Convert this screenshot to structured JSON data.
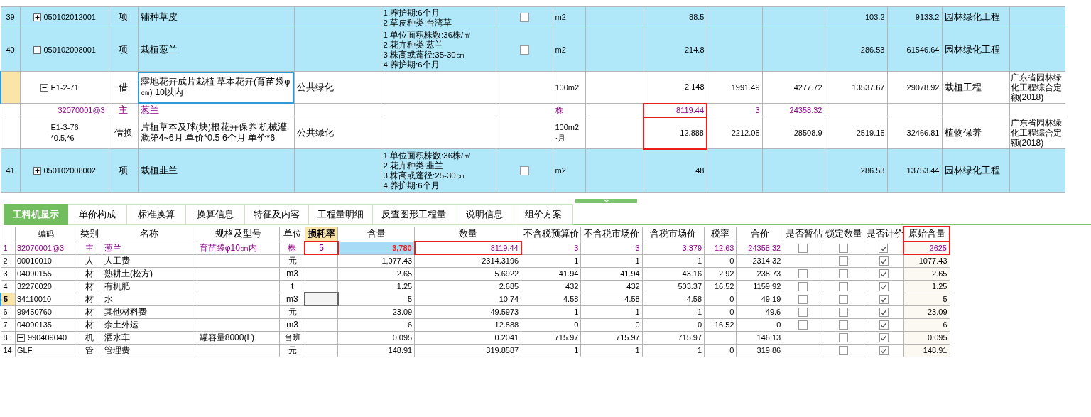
{
  "upper_grid": {
    "rows": [
      {
        "kind": "item",
        "number": "39",
        "current": false,
        "expanded": false,
        "code": "050102012001",
        "type": "项",
        "name": "铺种草皮",
        "features": [
          "1.养护期:6个月",
          "2.草皮种类:台湾草"
        ],
        "checked": false,
        "unit": "m2",
        "quantity": "88.5",
        "col_13": "103.2",
        "col_14": "9133.2",
        "category": "园林绿化工程",
        "quantity_highlighted": false
      },
      {
        "kind": "item",
        "number": "40",
        "current": false,
        "expanded": true,
        "code": "050102008001",
        "type": "项",
        "name": "栽植葱兰",
        "features": [
          "1.单位面积株数:36株/㎡",
          "2.花卉种类:葱兰",
          "3.株高或蓬径:35-30㎝",
          "4.养护期:6个月"
        ],
        "checked": false,
        "unit": "m2",
        "quantity": "214.8",
        "col_13": "286.53",
        "col_14": "61546.64",
        "category": "园林绿化工程",
        "quantity_highlighted": false,
        "children": [
          {
            "kind": "quota",
            "current": true,
            "expanded": true,
            "code": "E1-2-71",
            "type": "借",
            "name": "露地花卉成片栽植 草本花卉(育苗袋φ㎝) 10以内",
            "col_5": "公共绿化",
            "unit": "100m2",
            "quantity": "2.148",
            "col_11": "1991.49",
            "col_12": "4277.72",
            "col_13": "13537.67",
            "col_14": "29078.92",
            "category": "栽植工程",
            "col_16": "广东省园林绿化工程综合定额(2018)",
            "quantity_highlighted": false,
            "children": [
              {
                "kind": "material",
                "current": false,
                "code": "32070001@3",
                "type": "主",
                "name": "葱兰",
                "unit": "株",
                "quantity": "8119.44",
                "col_11": "3",
                "col_12": "24358.32",
                "quantity_highlighted": true
              }
            ]
          },
          {
            "kind": "quota",
            "current": false,
            "code": "E1-3-76\n*0.5,*6",
            "type": "借换",
            "name": "片植草本及球(块)根花卉保养 机械灌溉第4~6月 单价*0.5 6个月 单价*6",
            "col_5": "公共绿化",
            "unit": "100m2\n·月",
            "quantity": "12.888",
            "col_11": "2212.05",
            "col_12": "28508.9",
            "col_13": "2519.15",
            "col_14": "32466.81",
            "category": "植物保养",
            "col_16": "广东省园林绿化工程综合定额(2018)",
            "quantity_highlighted": true
          }
        ]
      },
      {
        "kind": "item",
        "number": "41",
        "current": false,
        "expanded": false,
        "code": "050102008002",
        "type": "项",
        "name": "栽植韭兰",
        "features": [
          "1.单位面积株数:36株/㎡",
          "2.花卉种类:韭兰",
          "3.株高或蓬径:25-30㎝",
          "4.养护期:6个月"
        ],
        "checked": false,
        "unit": "m2",
        "quantity": "48",
        "col_13": "286.53",
        "col_14": "13753.44",
        "category": "园林绿化工程",
        "quantity_highlighted": false
      }
    ]
  },
  "tabs": [
    {
      "label": "工料机显示",
      "selected": true
    },
    {
      "label": "单价构成",
      "selected": false
    },
    {
      "label": "标准换算",
      "selected": false
    },
    {
      "label": "换算信息",
      "selected": false
    },
    {
      "label": "特征及内容",
      "selected": false
    },
    {
      "label": "工程量明细",
      "selected": false
    },
    {
      "label": "反查图形工程量",
      "selected": false
    },
    {
      "label": "说明信息",
      "selected": false
    },
    {
      "label": "组价方案",
      "selected": false
    }
  ],
  "resource_grid": {
    "columns": [
      {
        "label": "编码",
        "selected": false,
        "highlighted": false
      },
      {
        "label": "类别",
        "selected": false,
        "highlighted": false
      },
      {
        "label": "名称",
        "selected": false,
        "highlighted": false
      },
      {
        "label": "规格及型号",
        "selected": false,
        "highlighted": false
      },
      {
        "label": "单位",
        "selected": false,
        "highlighted": false
      },
      {
        "label": "损耗率",
        "selected": true,
        "highlighted": false
      },
      {
        "label": "含量",
        "selected": false,
        "highlighted": false
      },
      {
        "label": "数量",
        "selected": false,
        "highlighted": false
      },
      {
        "label": "不含税预算价",
        "selected": false,
        "highlighted": false
      },
      {
        "label": "不含税市场价",
        "selected": false,
        "highlighted": false
      },
      {
        "label": "含税市场价",
        "selected": false,
        "highlighted": false
      },
      {
        "label": "税率",
        "selected": false,
        "highlighted": false
      },
      {
        "label": "合价",
        "selected": false,
        "highlighted": false
      },
      {
        "label": "是否暂估",
        "selected": false,
        "highlighted": false
      },
      {
        "label": "锁定数量",
        "selected": false,
        "highlighted": false
      },
      {
        "label": "是否计价",
        "selected": false,
        "highlighted": false
      },
      {
        "label": "原始含量",
        "selected": false,
        "highlighted": true
      }
    ],
    "rows": [
      {
        "number": "1",
        "kind": "main",
        "current": false,
        "expanded": null,
        "code": "32070001@3",
        "category": "主",
        "name": "葱兰",
        "spec": "育苗袋φ10㎝内",
        "unit": "株",
        "loss_rate": "5",
        "content": "3,780",
        "quantity": "8119.44",
        "budget_price": "3",
        "market_price": "3",
        "tax_market_price": "3.379",
        "tax_rate": "12.63",
        "total": "24358.32",
        "provisional": false,
        "locked": false,
        "priced": true,
        "original_content": "2625",
        "content_selected": true,
        "loss_rate_focused": false,
        "loss_rate_highlighted": true,
        "quantity_highlighted": true,
        "original_content_highlighted": true
      },
      {
        "number": "2",
        "kind": "normal",
        "current": false,
        "expanded": null,
        "code": "00010010",
        "category": "人",
        "name": "人工费",
        "unit": "元",
        "content": "1,077.43",
        "quantity": "2314.3196",
        "budget_price": "1",
        "market_price": "1",
        "tax_market_price": "1",
        "tax_rate": "0",
        "total": "2314.32",
        "provisional": null,
        "locked": false,
        "priced": true,
        "original_content": "1077.43",
        "content_selected": false,
        "loss_rate_focused": false,
        "loss_rate_highlighted": false,
        "quantity_highlighted": false,
        "original_content_highlighted": false
      },
      {
        "number": "3",
        "kind": "normal",
        "current": false,
        "expanded": null,
        "code": "04090155",
        "category": "材",
        "name": "熟耕土(松方)",
        "unit": "m3",
        "content": "2.65",
        "quantity": "5.6922",
        "budget_price": "41.94",
        "market_price": "41.94",
        "tax_market_price": "43.16",
        "tax_rate": "2.92",
        "total": "238.73",
        "provisional": false,
        "locked": false,
        "priced": true,
        "original_content": "2.65",
        "content_selected": false,
        "loss_rate_focused": false,
        "loss_rate_highlighted": false,
        "quantity_highlighted": false,
        "original_content_highlighted": false
      },
      {
        "number": "4",
        "kind": "normal",
        "current": false,
        "expanded": null,
        "code": "32270020",
        "category": "材",
        "name": "有机肥",
        "unit": "t",
        "content": "1.25",
        "quantity": "2.685",
        "budget_price": "432",
        "market_price": "432",
        "tax_market_price": "503.37",
        "tax_rate": "16.52",
        "total": "1159.92",
        "provisional": false,
        "locked": false,
        "priced": true,
        "original_content": "1.25",
        "content_selected": false,
        "loss_rate_focused": false,
        "loss_rate_highlighted": false,
        "quantity_highlighted": false,
        "original_content_highlighted": false
      },
      {
        "number": "5",
        "kind": "normal",
        "current": true,
        "expanded": null,
        "code": "34110010",
        "category": "材",
        "name": "水",
        "unit": "m3",
        "content": "5",
        "quantity": "10.74",
        "budget_price": "4.58",
        "market_price": "4.58",
        "tax_market_price": "4.58",
        "tax_rate": "0",
        "total": "49.19",
        "provisional": false,
        "locked": false,
        "priced": true,
        "original_content": "5",
        "content_selected": false,
        "loss_rate_focused": true,
        "loss_rate_highlighted": false,
        "quantity_highlighted": false,
        "original_content_highlighted": false
      },
      {
        "number": "6",
        "kind": "normal",
        "current": false,
        "expanded": null,
        "code": "99450760",
        "category": "材",
        "name": "其他材料费",
        "unit": "元",
        "content": "23.09",
        "quantity": "49.5973",
        "budget_price": "1",
        "market_price": "1",
        "tax_market_price": "1",
        "tax_rate": "0",
        "total": "49.6",
        "provisional": false,
        "locked": false,
        "priced": true,
        "original_content": "23.09",
        "content_selected": false,
        "loss_rate_focused": false,
        "loss_rate_highlighted": false,
        "quantity_highlighted": false,
        "original_content_highlighted": false
      },
      {
        "number": "7",
        "kind": "normal",
        "current": false,
        "expanded": null,
        "code": "04090135",
        "category": "材",
        "name": "余土外运",
        "unit": "m3",
        "content": "6",
        "quantity": "12.888",
        "budget_price": "0",
        "market_price": "0",
        "tax_market_price": "0",
        "tax_rate": "16.52",
        "total": "0",
        "provisional": false,
        "locked": false,
        "priced": true,
        "original_content": "6",
        "content_selected": false,
        "loss_rate_focused": false,
        "loss_rate_highlighted": false,
        "quantity_highlighted": false,
        "original_content_highlighted": false
      },
      {
        "number": "8",
        "kind": "normal",
        "current": false,
        "expanded": false,
        "code": "990409040",
        "category": "机",
        "name": "洒水车",
        "spec": "罐容量8000(L)",
        "unit": "台班",
        "content": "0.095",
        "quantity": "0.2041",
        "budget_price": "715.97",
        "market_price": "715.97",
        "tax_market_price": "715.97",
        "total": "146.13",
        "provisional": null,
        "locked": false,
        "priced": true,
        "original_content": "0.095",
        "content_selected": false,
        "loss_rate_focused": false,
        "loss_rate_highlighted": false,
        "quantity_highlighted": false,
        "original_content_highlighted": false
      },
      {
        "number": "14",
        "kind": "normal",
        "current": false,
        "expanded": null,
        "code": "GLF",
        "category": "管",
        "name": "管理费",
        "unit": "元",
        "content": "148.91",
        "quantity": "319.8587",
        "budget_price": "1",
        "market_price": "1",
        "tax_market_price": "1",
        "tax_rate": "0",
        "total": "319.86",
        "provisional": null,
        "locked": false,
        "priced": true,
        "original_content": "148.91",
        "content_selected": false,
        "loss_rate_focused": false,
        "loss_rate_highlighted": false,
        "quantity_highlighted": false,
        "original_content_highlighted": false
      }
    ]
  }
}
